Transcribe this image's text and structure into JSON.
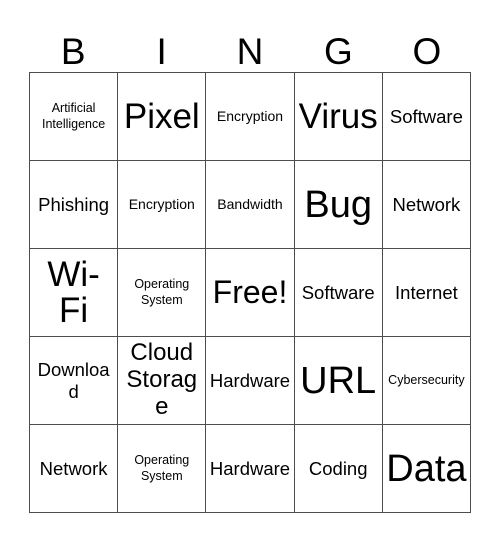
{
  "card": {
    "title": "BINGO",
    "header_letters": [
      "B",
      "I",
      "N",
      "G",
      "O"
    ],
    "grid_size": "5x5",
    "free_space": "Free!",
    "colors": {
      "background": "#ffffff",
      "cell_background": "#ffffff",
      "border": "#4d4d4d",
      "text": "#000000"
    },
    "cells": [
      [
        {
          "text": "Artificial Intelligence",
          "size": "fs-xs"
        },
        {
          "text": "Pixel",
          "size": "fs-xxl"
        },
        {
          "text": "Encryption",
          "size": "fs-sm"
        },
        {
          "text": "Virus",
          "size": "fs-xxl"
        },
        {
          "text": "Software",
          "size": "fs-md"
        }
      ],
      [
        {
          "text": "Phishing",
          "size": "fs-md"
        },
        {
          "text": "Encryption",
          "size": "fs-sm"
        },
        {
          "text": "Bandwidth",
          "size": "fs-sm"
        },
        {
          "text": "Bug",
          "size": "fs-xxxl"
        },
        {
          "text": "Network",
          "size": "fs-md"
        }
      ],
      [
        {
          "text": "Wi-Fi",
          "size": "fs-xxl"
        },
        {
          "text": "Operating System",
          "size": "fs-xs"
        },
        {
          "text": "Free!",
          "size": "fs-xl"
        },
        {
          "text": "Software",
          "size": "fs-md"
        },
        {
          "text": "Internet",
          "size": "fs-md"
        }
      ],
      [
        {
          "text": "Download",
          "size": "fs-md"
        },
        {
          "text": "Cloud Storage",
          "size": "fs-lg"
        },
        {
          "text": "Hardware",
          "size": "fs-md"
        },
        {
          "text": "URL",
          "size": "fs-xxxl"
        },
        {
          "text": "Cybersecurity",
          "size": "fs-xs"
        }
      ],
      [
        {
          "text": "Network",
          "size": "fs-md"
        },
        {
          "text": "Operating System",
          "size": "fs-xs"
        },
        {
          "text": "Hardware",
          "size": "fs-md"
        },
        {
          "text": "Coding",
          "size": "fs-md"
        },
        {
          "text": "Data",
          "size": "fs-xxxl"
        }
      ]
    ]
  }
}
